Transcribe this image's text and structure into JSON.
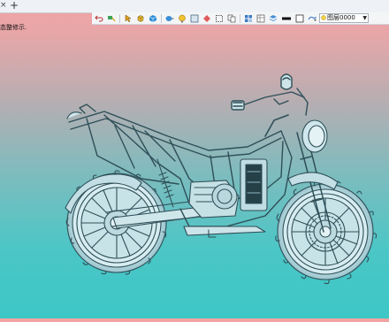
{
  "tabs": {
    "close_glyph": "×",
    "new_tab_glyph": "+"
  },
  "toolbar": {
    "icons": [
      "undo-icon",
      "paint-icon",
      "pointer-icon",
      "cube-icon",
      "box-icon",
      "view-icon",
      "lightbulb-icon",
      "frame-icon",
      "snap-icon",
      "rect-select-icon",
      "copy-icon",
      "grid-icon",
      "layer-icon",
      "layer-props-icon",
      "line-weight-icon",
      "color-swatch-icon",
      "filter-icon"
    ],
    "layer_value": "图层0000",
    "layer_caret": "▼"
  },
  "command_prompt": "态整修示.",
  "colors": {
    "accent_teal": "#3cc7c6",
    "accent_pink": "#f3a3a3",
    "model_fill": "#b7dde3",
    "model_edge": "#2f4f58"
  }
}
